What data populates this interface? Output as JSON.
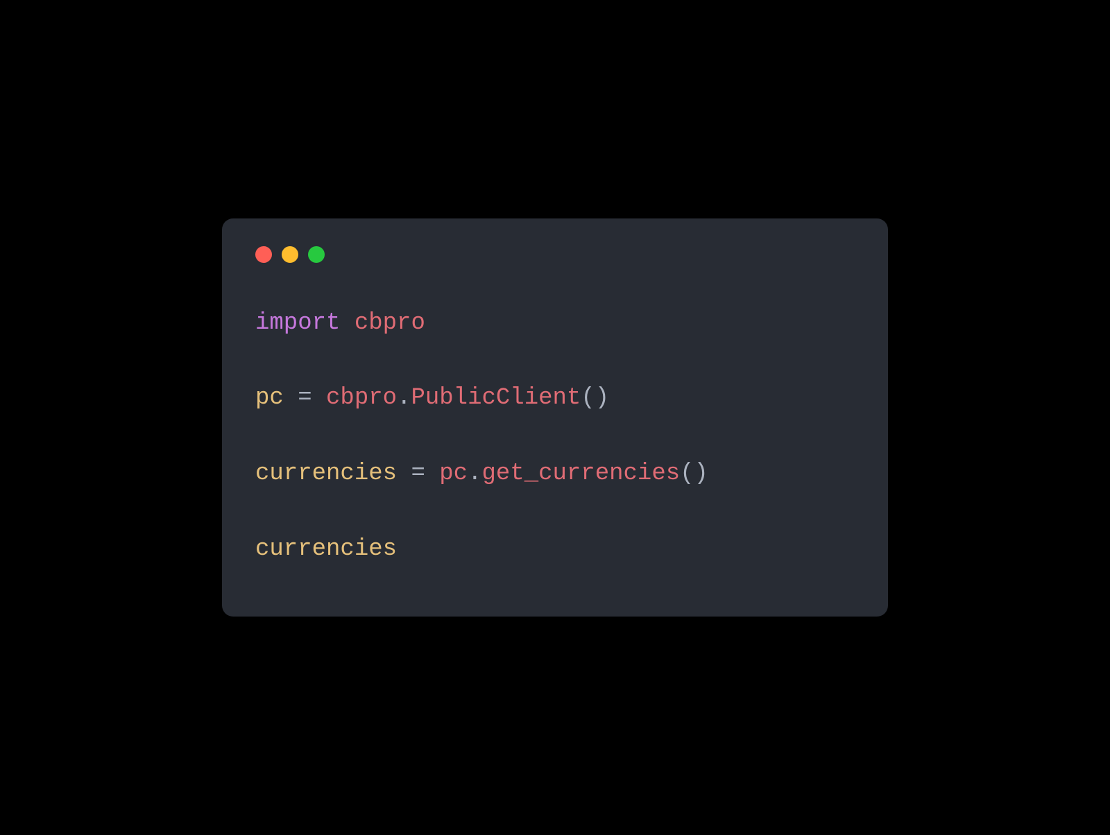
{
  "colors": {
    "background": "#000000",
    "window": "#282c34",
    "close": "#ff5f56",
    "minimize": "#ffbd2e",
    "maximize": "#27c93f",
    "keyword": "#c678dd",
    "module": "#e06c75",
    "variable": "#e5c07b",
    "operator": "#abb2bf",
    "call": "#e06c75",
    "paren": "#abb2bf"
  },
  "code": {
    "line1": {
      "keyword": "import",
      "space": " ",
      "module": "cbpro"
    },
    "blank1": "",
    "line2": {
      "var": "pc",
      "sp1": " ",
      "op": "=",
      "sp2": " ",
      "obj": "cbpro",
      "dot": ".",
      "call": "PublicClient",
      "paren": "()"
    },
    "blank2": "",
    "line3": {
      "var": "currencies",
      "sp1": " ",
      "op": "=",
      "sp2": " ",
      "obj": "pc",
      "dot": ".",
      "call": "get_currencies",
      "paren": "()"
    },
    "blank3": "",
    "line4": {
      "var": "currencies"
    }
  }
}
